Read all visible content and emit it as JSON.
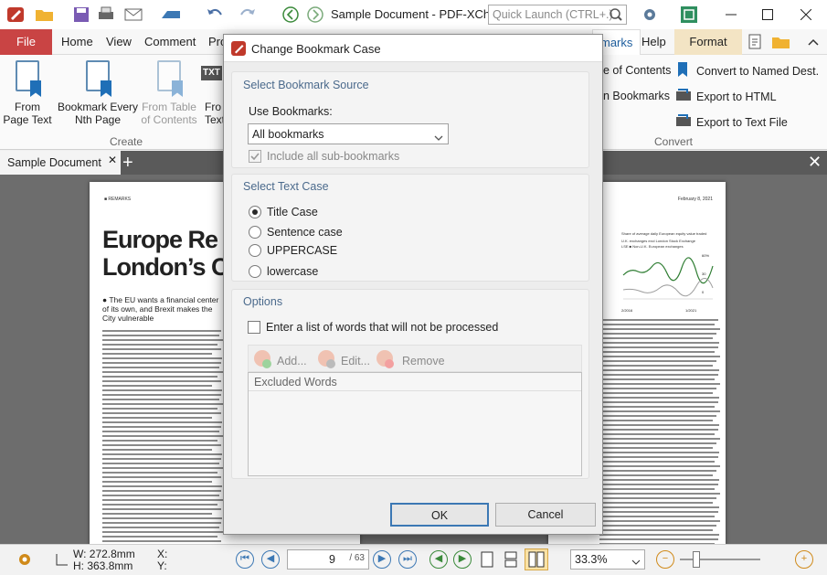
{
  "titlebar": {
    "title": "Sample Document - PDF-XCha...",
    "quick_launch_placeholder": "Quick Launch (CTRL+.)"
  },
  "ribbon_tabs": [
    {
      "label": "File"
    },
    {
      "label": "Home"
    },
    {
      "label": "View"
    },
    {
      "label": "Comment"
    },
    {
      "label": "Pro"
    },
    {
      "label": "marks"
    },
    {
      "label": "Help"
    },
    {
      "label": "Format"
    }
  ],
  "ribbon": {
    "create_buttons": [
      {
        "label1": "From",
        "label2": "Page Text"
      },
      {
        "label1": "Bookmark Every",
        "label2": "Nth Page"
      },
      {
        "label1": "From Table",
        "label2": "of Contents"
      },
      {
        "label1": "Fro",
        "label2": "Text"
      }
    ],
    "create_group": "Create",
    "mid_items": [
      "e of Contents",
      "n Bookmarks"
    ],
    "convert_items": [
      "Convert to Named Dest.",
      "Export to HTML",
      "Export to Text File"
    ],
    "convert_group": "Convert",
    "txt_badge": "TXT"
  },
  "doctab": {
    "label": "Sample Document",
    "add": "+",
    "close": "✕"
  },
  "page_left": {
    "header": "■ REMARKS",
    "headline1": "Europe Re",
    "headline2": "London’s C",
    "lede1": "● The EU wants a financial center",
    "lede2": "of its own, and Brexit makes the",
    "lede3": "City vulnerable"
  },
  "page_right": {
    "date": "February 8, 2021",
    "chart_title": "Share of average daily European equity value traded",
    "legend1": "U.K. exchanges excl London Stock Exchange",
    "legend2": "LSE  ■ Non-U.K. European exchanges",
    "tick_60": "60%",
    "tick_30": "30",
    "tick_0": "0",
    "date1": "2/2016",
    "date2": "1/2021"
  },
  "dialog": {
    "title": "Change Bookmark Case",
    "source_header": "Select Bookmark Source",
    "use_label": "Use Bookmarks:",
    "use_value": "All bookmarks",
    "include_sub": "Include all sub-bookmarks",
    "case_header": "Select Text Case",
    "cases": [
      "Title Case",
      "Sentence case",
      "UPPERCASE",
      "lowercase"
    ],
    "options_header": "Options",
    "enter_list": "Enter a list of words that will not be processed",
    "add": "Add...",
    "edit": "Edit...",
    "remove": "Remove",
    "excluded_header": "Excluded Words",
    "ok": "OK",
    "cancel": "Cancel"
  },
  "status": {
    "w": "W: 272.8mm",
    "h": "H: 363.8mm",
    "x": "X:",
    "y": "Y:",
    "page": "9",
    "total": "/ 63",
    "zoom": "33.3%"
  },
  "colors": {
    "accent": "#c0392b",
    "file_tab": "#c94444",
    "link_blue": "#3c78b4"
  }
}
